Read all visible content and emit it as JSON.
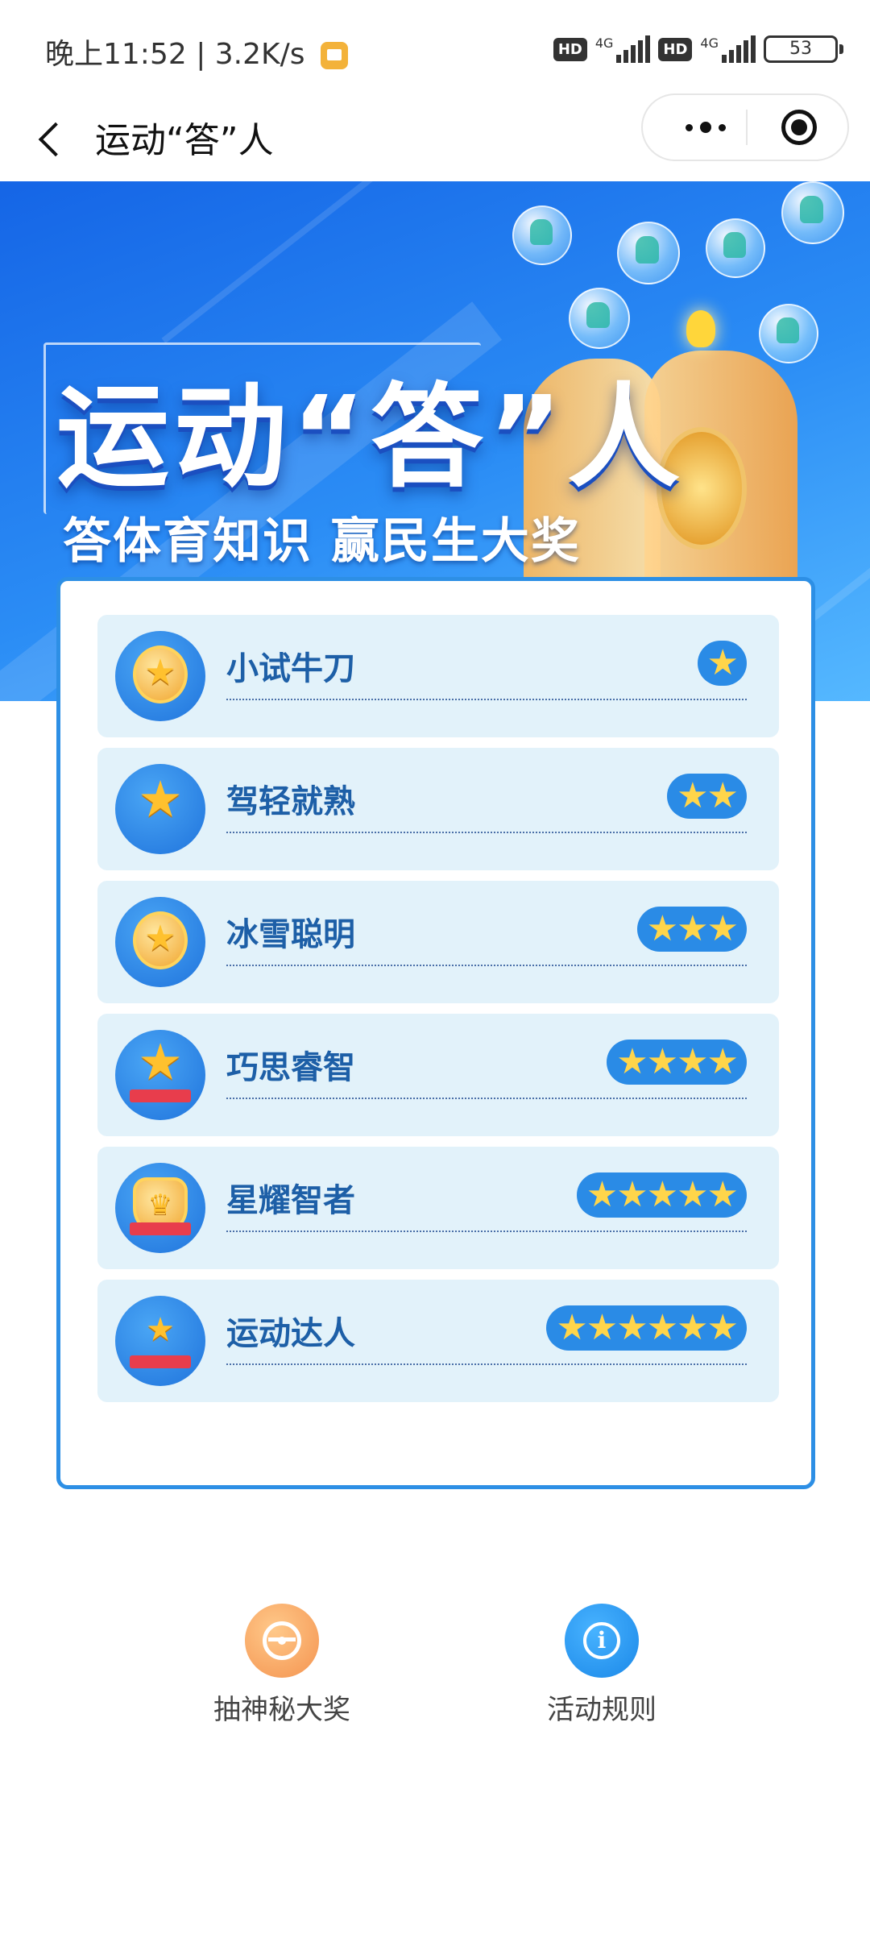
{
  "status_bar": {
    "time": "晚上11:52 | 3.2K/s",
    "battery": "53",
    "hd": "HD",
    "network": "4G"
  },
  "nav": {
    "title": "运动“答”人"
  },
  "banner": {
    "title": "运动“答”人",
    "subtitle": "答体育知识  赢民生大奖"
  },
  "levels": [
    {
      "name": "小试牛刀",
      "stars": "★"
    },
    {
      "name": "驾轻就熟",
      "stars": "★★"
    },
    {
      "name": "冰雪聪明",
      "stars": "★★★"
    },
    {
      "name": "巧思睿智",
      "stars": "★★★★"
    },
    {
      "name": "星耀智者",
      "stars": "★★★★★"
    },
    {
      "name": "运动达人",
      "stars": "★★★★★★"
    }
  ],
  "actions": {
    "lottery_label": "抽神秘大奖",
    "rules_label": "活动规则"
  },
  "colors": {
    "accent_blue": "#2a8be6",
    "card_border": "#2d8fe5",
    "level_bg": "#e2f2fa",
    "level_text": "#1d5fa7",
    "star": "#ffd54a"
  }
}
